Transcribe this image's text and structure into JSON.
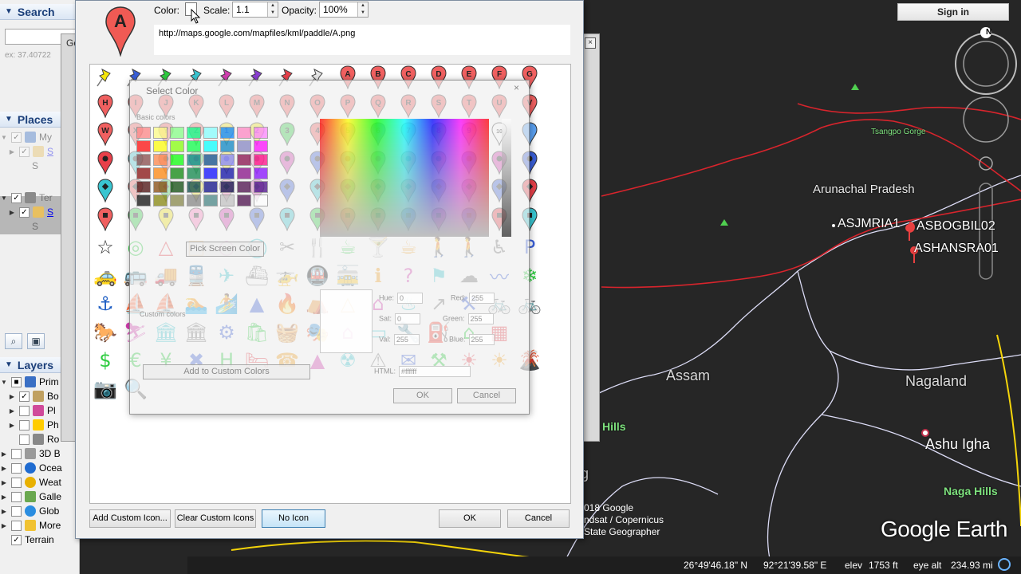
{
  "left_panel": {
    "search": {
      "title": "Search",
      "placeholder": "",
      "hint": "ex: 37.40722"
    },
    "places": {
      "title": "Places",
      "items": [
        {
          "label": "My",
          "indent": 1
        },
        {
          "label": "S",
          "indent": 2
        },
        {
          "label": "S",
          "indent": 3
        },
        {
          "label": "Ter",
          "indent": 1
        },
        {
          "label": "S",
          "indent": 2
        },
        {
          "label": "S",
          "indent": 3
        }
      ]
    },
    "layers": {
      "title": "Layers",
      "items": [
        {
          "label": "Prim",
          "color": "#3a6fc4"
        },
        {
          "label": "Bo",
          "color": "#c0a060"
        },
        {
          "label": "Pl",
          "color": "#d04a9a"
        },
        {
          "label": "Ph",
          "color": "#ffcc00"
        },
        {
          "label": "Ro",
          "color": "#888888"
        },
        {
          "label": "3D B",
          "color": "#9a9a9a"
        },
        {
          "label": "Ocea",
          "color": "#1f6bd0"
        },
        {
          "label": "Weat",
          "color": "#e8b000"
        },
        {
          "label": "Galle",
          "color": "#6aa84f"
        },
        {
          "label": "Glob",
          "color": "#2a8de0"
        },
        {
          "label": "More",
          "color": "#f1c232"
        },
        {
          "label": "Terrain",
          "color": "#f0f0f0"
        }
      ]
    }
  },
  "map": {
    "labels": {
      "tsangpo": "Tsangpo Gorge",
      "arunachal": "Arunachal Pradesh",
      "asjmria": "ASJMRIA1",
      "asbogbil": "ASBOGBIL02",
      "ashansra": "ASHANSRA01",
      "assam": "Assam",
      "nagaland": "Nagaland",
      "ashu": "Ashu Igha",
      "naga_hills": "Naga Hills",
      "hills_left": "Hills",
      "g_left": "g"
    },
    "compass_letter": "N",
    "attribution": [
      "018 Google",
      "ndsat / Copernicus",
      "State Geographer"
    ],
    "logo": "Google Earth",
    "signin": "Sign in",
    "status": {
      "lat": "26°49'46.18\" N",
      "lon": "92°21'39.58\" E",
      "elev_label": "elev",
      "elev": "1753 ft",
      "eye_label": "eye alt",
      "eye": "234.93 mi"
    }
  },
  "background_dialog": {
    "title": "Go",
    "close": "×"
  },
  "icon_dialog": {
    "preview_letter": "A",
    "color_label": "Color:",
    "scale_label": "Scale:",
    "scale_value": "1.1",
    "opacity_label": "Opacity:",
    "opacity_value": "100%",
    "url": "http://maps.google.com/mapfiles/kml/paddle/A.png",
    "row0_letters": [
      "A",
      "B",
      "C",
      "D",
      "E",
      "F",
      "G"
    ],
    "row1_letters": [
      "H",
      "I",
      "J",
      "K",
      "L",
      "M",
      "N",
      "O",
      "P",
      "Q",
      "R",
      "S",
      "T",
      "U",
      "V"
    ],
    "row2_letters": [
      "W",
      "X",
      "Y",
      "Z",
      "1",
      "2",
      "3",
      "4",
      "5",
      "6",
      "7",
      "8",
      "9",
      "10"
    ],
    "buttons": {
      "add_custom": "Add Custom Icon...",
      "clear_custom": "Clear Custom Icons",
      "no_icon": "No Icon",
      "ok": "OK",
      "cancel": "Cancel"
    }
  },
  "color_dialog": {
    "title": "Select Color",
    "close": "×",
    "basic_colors_label": "Basic colors",
    "custom_colors_label": "Custom colors",
    "pick_screen": "Pick Screen Color",
    "add_custom": "Add to Custom Colors",
    "hue_label": "Hue:",
    "hue": "0",
    "sat_label": "Sat:",
    "sat": "0",
    "val_label": "Val:",
    "val": "255",
    "red_label": "Red:",
    "red": "255",
    "green_label": "Green:",
    "green": "255",
    "blue_label": "Blue:",
    "blue": "255",
    "html_label": "HTML:",
    "html": "#ffffff",
    "ok": "OK",
    "cancel": "Cancel",
    "basic_colors": [
      "#ff8080",
      "#ffff80",
      "#80ff80",
      "#00ff80",
      "#80ffff",
      "#0080ff",
      "#ff80c0",
      "#ff80ff",
      "#ff0000",
      "#ffff00",
      "#80ff00",
      "#00ff40",
      "#00ffff",
      "#0080c0",
      "#8080c0",
      "#ff00ff",
      "#804040",
      "#ff8040",
      "#00ff00",
      "#008080",
      "#004080",
      "#8080ff",
      "#800040",
      "#ff0080",
      "#800000",
      "#ff8000",
      "#008000",
      "#008040",
      "#0000ff",
      "#0000a0",
      "#800080",
      "#8000ff",
      "#400000",
      "#804000",
      "#004000",
      "#004040",
      "#000080",
      "#000040",
      "#400040",
      "#400080",
      "#000000",
      "#808000",
      "#808040",
      "#808080",
      "#408080",
      "#c0c0c0",
      "#400040",
      "#ffffff"
    ]
  }
}
